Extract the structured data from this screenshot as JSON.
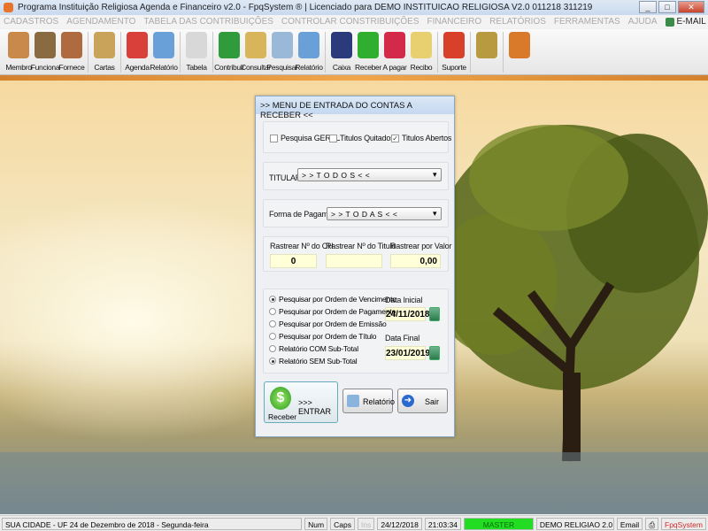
{
  "window": {
    "title": "Programa Instituição Religiosa Agenda e Financeiro v2.0 - FpqSystem ® | Licenciado para  DEMO INSTITUICAO RELIGIOSA V2.0 011218 311219",
    "minimize": "_",
    "maximize": "□",
    "close": "✕"
  },
  "menu": [
    "CADASTROS",
    "AGENDAMENTO",
    "TABELA DAS CONTRIBUIÇÕES",
    "CONTROLAR CONSTRIBUIÇÕES",
    "FINANCEIRO",
    "RELATÓRIOS",
    "FERRAMENTAS",
    "AJUDA"
  ],
  "menu_email": "E-MAIL",
  "toolbar": [
    {
      "label": "Membro",
      "icon": "members-icon",
      "color": "#c9894a"
    },
    {
      "label": "Funciona",
      "icon": "employee-icon",
      "color": "#8a6a40"
    },
    {
      "label": "Fornece",
      "icon": "supplier-icon",
      "color": "#b06a40"
    },
    {
      "label": "Cartas",
      "icon": "scroll-icon",
      "color": "#c9a35a",
      "sep": true
    },
    {
      "label": "Agenda",
      "icon": "calendar-icon",
      "color": "#d9403a",
      "sep": true
    },
    {
      "label": "Relatório",
      "icon": "printer-icon",
      "color": "#6aa0d8"
    },
    {
      "label": "Tabela",
      "icon": "document-chart-icon",
      "color": "#d8d8d8",
      "sep": true
    },
    {
      "label": "Contribuir",
      "icon": "dollar-list-icon",
      "color": "#2f9b3a",
      "sep": true
    },
    {
      "label": "Consultar",
      "icon": "file-box-icon",
      "color": "#d8b45a"
    },
    {
      "label": "Pesquisar",
      "icon": "search-document-icon",
      "color": "#9ab8d8"
    },
    {
      "label": "Relatório",
      "icon": "printer-icon",
      "color": "#6aa0d8"
    },
    {
      "label": "Caixa",
      "icon": "cash-book-icon",
      "color": "#2a3a7a",
      "sep": true
    },
    {
      "label": "Receber",
      "icon": "receive-dollar-icon",
      "color": "#2fae2f"
    },
    {
      "label": "A pagar",
      "icon": "pay-dollar-icon",
      "color": "#d42a4a"
    },
    {
      "label": "Recibo",
      "icon": "receipt-icon",
      "color": "#e8d070"
    },
    {
      "label": "Suporte",
      "icon": "support-icon",
      "color": "#d8402a",
      "sep": true
    },
    {
      "label": "",
      "icon": "coins-icon",
      "color": "#b89a40",
      "sep": true
    },
    {
      "label": "",
      "icon": "exit-door-icon",
      "color": "#d87a2a",
      "sep": true
    }
  ],
  "dialog": {
    "title": ">>  MENU DE ENTRADA DO CONTAS A RECEBER  <<",
    "checks": [
      {
        "label": "Pesquisa GERAL",
        "checked": false
      },
      {
        "label": "Titulos Quitados",
        "checked": false
      },
      {
        "label": "Titulos Abertos",
        "checked": true
      }
    ],
    "titular_label": "TITULAR",
    "titular_value": "> > T O D O S < <",
    "forma_label": "Forma de Pagamento",
    "forma_value": "> > T O D A S < <",
    "rastrear": [
      {
        "label": "Rastrear Nº do CH",
        "value": "0"
      },
      {
        "label": "Rastrear Nº do Titulo",
        "value": ""
      },
      {
        "label": "Rastrear por Valor",
        "value": "0,00"
      }
    ],
    "radios": [
      {
        "label": "Pesquisar por Ordem de Vencimento",
        "selected": true
      },
      {
        "label": "Pesquisar por Ordem de Pagamento",
        "selected": false
      },
      {
        "label": "Pesquisar por Ordem de Emissão",
        "selected": false
      },
      {
        "label": "Pesquisar por Ordem de Título",
        "selected": false
      },
      {
        "label": "Relatório COM Sub-Total",
        "selected": false
      },
      {
        "label": "Relatório SEM Sub-Total",
        "selected": true
      }
    ],
    "data_inicial_label": "Data Inicial",
    "data_inicial": "24/11/2018",
    "data_final_label": "Data Final",
    "data_final": "23/01/2019",
    "enter_label": ">>> ENTRAR",
    "enter_sub": "Receber",
    "report_label": "Relatório",
    "exit_label": "Sair"
  },
  "status": {
    "city": "SUA CIDADE - UF 24 de Dezembro de 2018 - Segunda-feira",
    "num": "Num",
    "caps": "Caps",
    "ins": "Ins",
    "date": "24/12/2018",
    "time": "21:03:34",
    "user": "MASTER",
    "db": "DEMO RELIGIAO 2.0",
    "email": "Email",
    "brand": "FpqSystem"
  }
}
